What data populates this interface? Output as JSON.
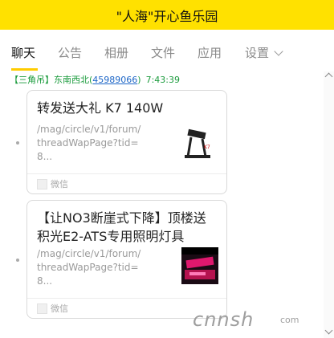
{
  "window": {
    "title": "\"人海\"开心鱼乐园"
  },
  "tabs": [
    {
      "label": "聊天",
      "active": true
    },
    {
      "label": "公告"
    },
    {
      "label": "相册"
    },
    {
      "label": "文件"
    },
    {
      "label": "应用"
    },
    {
      "label": "设置"
    }
  ],
  "message": {
    "sender_tag": "【三角吊】东南西北(",
    "sender_qq": "45989066",
    "sender_close": ")",
    "time": "7:43:39"
  },
  "cards": [
    {
      "title": "转发送大礼 K7 140W",
      "url": "/mag/circle/v1/forum/threadWapPage?tid=8...",
      "source": "微信",
      "thumb_icon": "lamp-product-thumbnail"
    },
    {
      "title": "【让NO3断崖式下降】顶楼送积光E2-ATS专用照明灯具",
      "url": "/mag/circle/v1/forum/threadWapPage?tid=8...",
      "source": "微信",
      "thumb_icon": "light-fixture-thumbnail"
    }
  ],
  "watermark": {
    "text": "cnnsh",
    "sub": "com"
  },
  "colors": {
    "titlebar": "#ffe100",
    "tab_underline": "#ffcc00",
    "sender": "#1a9b3c",
    "qq_link": "#1d66c7"
  }
}
